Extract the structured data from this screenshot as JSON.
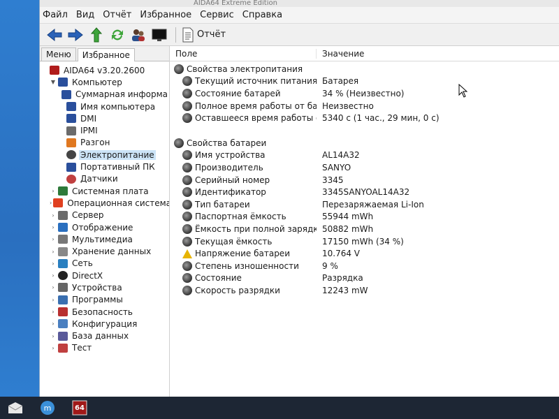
{
  "window": {
    "title": "AIDA64 Extreme Edition"
  },
  "menu": [
    "Файл",
    "Вид",
    "Отчёт",
    "Избранное",
    "Сервис",
    "Справка"
  ],
  "toolbar": {
    "buttons": [
      "back-arrow-icon",
      "forward-arrow-icon",
      "up-arrow-icon",
      "refresh-icon",
      "users-icon",
      "monitor-icon"
    ],
    "report_label": "Отчёт"
  },
  "tabs": {
    "menu": "Меню",
    "favorites": "Избранное"
  },
  "tree": [
    {
      "label": "AIDA64 v3.20.2600",
      "icon": "aida64-icon"
    },
    {
      "label": "Компьютер",
      "icon": "computer-icon"
    },
    {
      "label": "Суммарная информа",
      "icon": "computer-icon"
    },
    {
      "label": "Имя компьютера",
      "icon": "computer-icon"
    },
    {
      "label": "DMI",
      "icon": "computer-icon"
    },
    {
      "label": "IPMI",
      "icon": "server-icon"
    },
    {
      "label": "Разгон",
      "icon": "fire-icon"
    },
    {
      "label": "Электропитание",
      "icon": "power-icon"
    },
    {
      "label": "Портативный ПК",
      "icon": "laptop-icon"
    },
    {
      "label": "Датчики",
      "icon": "sensor-icon"
    },
    {
      "label": "Системная плата",
      "icon": "motherboard-icon"
    },
    {
      "label": "Операционная система",
      "icon": "windows-icon"
    },
    {
      "label": "Сервер",
      "icon": "server-icon"
    },
    {
      "label": "Отображение",
      "icon": "display-icon"
    },
    {
      "label": "Мультимедиа",
      "icon": "multimedia-icon"
    },
    {
      "label": "Хранение данных",
      "icon": "storage-icon"
    },
    {
      "label": "Сеть",
      "icon": "network-icon"
    },
    {
      "label": "DirectX",
      "icon": "directx-icon"
    },
    {
      "label": "Устройства",
      "icon": "devices-icon"
    },
    {
      "label": "Программы",
      "icon": "programs-icon"
    },
    {
      "label": "Безопасность",
      "icon": "security-icon"
    },
    {
      "label": "Конфигурация",
      "icon": "config-icon"
    },
    {
      "label": "База данных",
      "icon": "database-icon"
    },
    {
      "label": "Тест",
      "icon": "test-icon"
    }
  ],
  "columns": {
    "field": "Поле",
    "value": "Значение"
  },
  "power_group": "Свойства электропитания",
  "power": [
    {
      "field": "Текущий источник питания",
      "value": "Батарея"
    },
    {
      "field": "Состояние батарей",
      "value": "34 % (Неизвестно)"
    },
    {
      "field": "Полное время работы от бата...",
      "value": "Неизвестно"
    },
    {
      "field": "Оставшееся время работы от ...",
      "value": "5340 с (1 час., 29 мин, 0 с)"
    }
  ],
  "battery_group": "Свойства батареи",
  "battery": [
    {
      "field": "Имя устройства",
      "value": "AL14A32"
    },
    {
      "field": "Производитель",
      "value": "SANYO"
    },
    {
      "field": "Серийный номер",
      "value": "3345"
    },
    {
      "field": "Идентификатор",
      "value": "3345SANYOAL14A32"
    },
    {
      "field": "Тип батареи",
      "value": "Перезаряжаемая Li-Ion"
    },
    {
      "field": "Паспортная ёмкость",
      "value": "55944 mWh"
    },
    {
      "field": "Ёмкость при полной зарядке",
      "value": "50882 mWh"
    },
    {
      "field": "Текущая ёмкость",
      "value": "17150 mWh  (34 %)"
    },
    {
      "field": "Напряжение батареи",
      "value": "10.764 V"
    },
    {
      "field": "Степень изношенности",
      "value": "9 %"
    },
    {
      "field": "Состояние",
      "value": "Разрядка"
    },
    {
      "field": "Скорость разрядки",
      "value": "12243 mW"
    }
  ],
  "taskbar": [
    "mail-icon",
    "media-icon",
    "aida64-icon"
  ],
  "taskbar_aida_label": "64"
}
